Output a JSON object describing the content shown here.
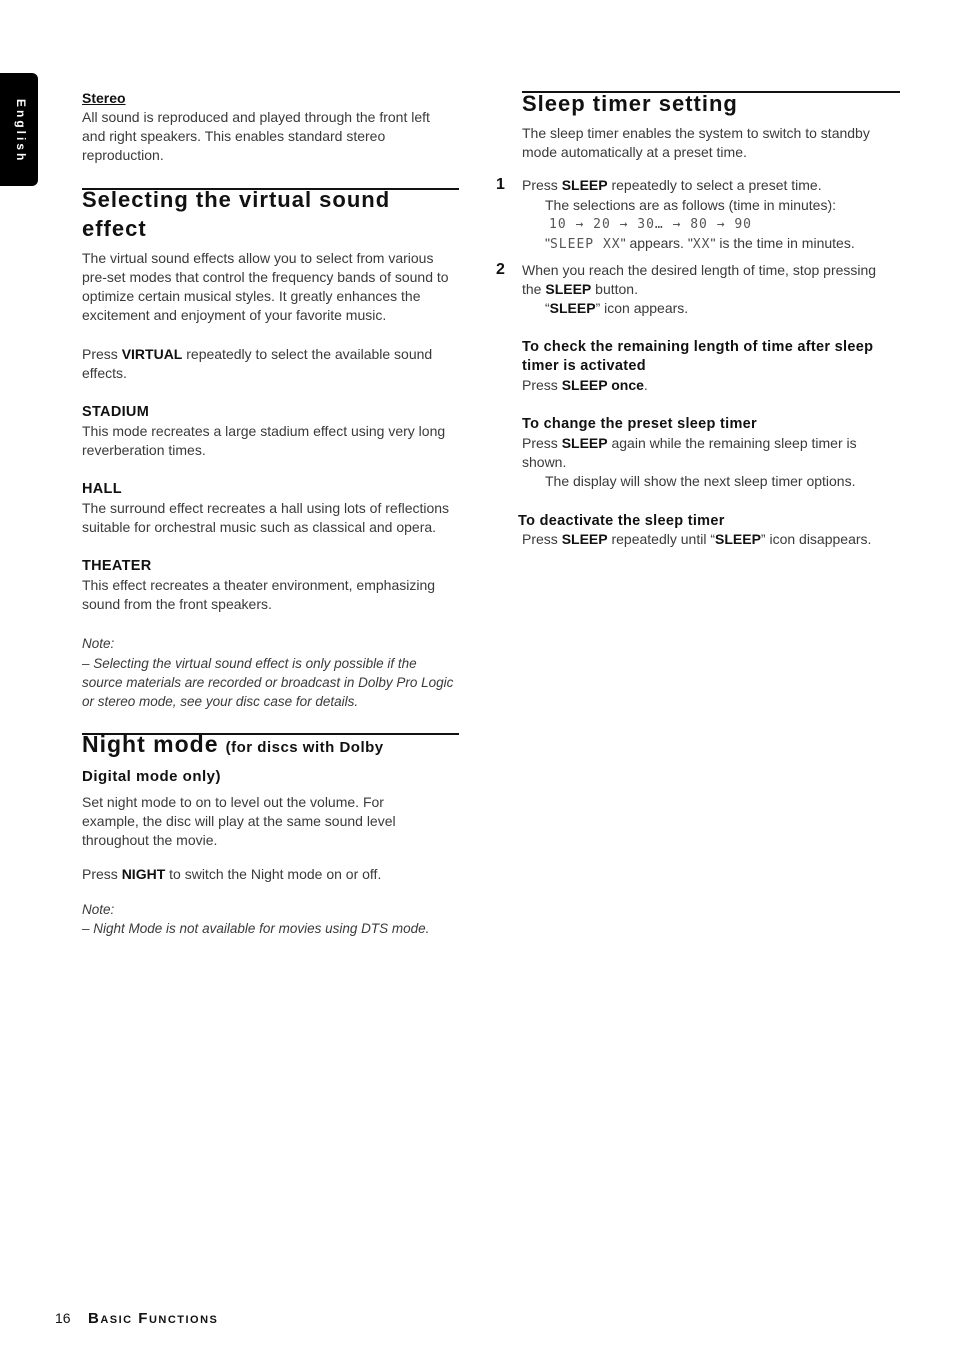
{
  "side_tab": "English",
  "left": {
    "stereo_title": "Stereo",
    "stereo_text": "All sound is reproduced and played through the front left and right speakers.  This enables standard stereo reproduction.",
    "virtual_heading": "Selecting the virtual sound effect",
    "virtual_text": "The virtual sound effects allow you to select from various pre-set modes that control the frequency bands of sound to optimize certain musical styles. It greatly enhances the excitement and enjoyment of your favorite music.",
    "virtual_press": [
      {
        "t": "Press "
      },
      {
        "t": "VIRTUAL",
        "b": true
      },
      {
        "t": " repeatedly to select the available sound effects."
      }
    ],
    "modes": [
      {
        "name": "STADIUM",
        "text": "This mode recreates a large stadium effect using very long reverberation times."
      },
      {
        "name": "HALL",
        "text": "The surround effect recreates a hall using lots of reflections suitable for orchestral music such as classical and opera."
      },
      {
        "name": "THEATER",
        "text": "This effect recreates a theater environment, emphasizing sound from the front speakers."
      }
    ],
    "note1_label": "Note:",
    "note1_text": "–   Selecting the virtual sound effect is only possible if the source materials are recorded or broadcast in Dolby Pro Logic or stereo mode, see your disc case for details.",
    "night_heading": "Night mode",
    "night_heading_small1": "(for discs with Dolby",
    "night_heading_small2": "Digital mode only)",
    "night_text": "Set night mode to on to level out the volume.  For example, the disc will play at the same sound level throughout the movie.",
    "night_press": [
      {
        "t": "Press "
      },
      {
        "t": "NIGHT",
        "b": true
      },
      {
        "t": " to switch the Night mode on or off."
      }
    ],
    "note2_label": "Note:",
    "note2_text": "–   Night Mode is not available for movies using DTS mode."
  },
  "right": {
    "heading": "Sleep timer setting",
    "intro": "The sleep timer enables the system to switch to standby mode automatically at a preset time.",
    "step1_num": "1",
    "step1": [
      {
        "t": "Press "
      },
      {
        "t": "SLEEP",
        "b": true
      },
      {
        "t": " repeatedly to select a preset time."
      }
    ],
    "step1_sub1": "The selections are as follows (time in minutes):",
    "step1_lcd": "10 → 20 → 30…   → 80 → 90",
    "step1_sub2": [
      {
        "t": "\""
      },
      {
        "t": "SLEEP  XX",
        "lcd": true
      },
      {
        "t": "\" appears. \""
      },
      {
        "t": "XX",
        "lcd": true
      },
      {
        "t": "\" is the time in minutes."
      }
    ],
    "step2_num": "2",
    "step2": [
      {
        "t": "When you reach the desired length of time, stop pressing the "
      },
      {
        "t": "SLEEP",
        "b": true
      },
      {
        "t": " button."
      }
    ],
    "step2_sub": [
      {
        "t": "“"
      },
      {
        "t": "SLEEP",
        "b": true
      },
      {
        "t": "” icon appears."
      }
    ],
    "check_heading": "To check the remaining length of time after sleep timer is activated",
    "check_text": [
      {
        "t": "Press "
      },
      {
        "t": "SLEEP once",
        "b": true
      },
      {
        "t": "."
      }
    ],
    "change_heading": "To change the preset sleep timer",
    "change_text": [
      {
        "t": "Press "
      },
      {
        "t": "SLEEP",
        "b": true
      },
      {
        "t": " again while the remaining sleep timer is shown."
      }
    ],
    "change_sub": "The display will show the next sleep timer options.",
    "deact_heading": "To deactivate the sleep timer",
    "deact_text": [
      {
        "t": "Press "
      },
      {
        "t": "SLEEP",
        "b": true
      },
      {
        "t": " repeatedly until “"
      },
      {
        "t": "SLEEP",
        "b": true
      },
      {
        "t": "” icon disappears."
      }
    ]
  },
  "footer": {
    "page_number": "16",
    "section": "Basic Functions"
  }
}
